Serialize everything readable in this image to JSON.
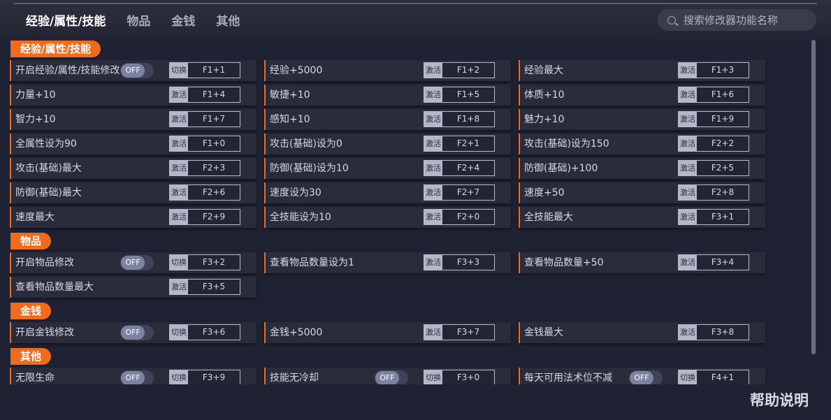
{
  "tabs": [
    {
      "label": "经验/属性/技能"
    },
    {
      "label": "物品"
    },
    {
      "label": "金钱"
    },
    {
      "label": "其他"
    }
  ],
  "search": {
    "placeholder": "搜索修改器功能名称"
  },
  "toggle_off": "OFF",
  "sections": [
    {
      "title": "经验/属性/技能",
      "rows": [
        [
          {
            "label": "开启经验/属性/技能修改",
            "toggle": true,
            "action": "切换",
            "hotkey": "F1+1"
          },
          {
            "label": "经验+5000",
            "action": "激活",
            "hotkey": "F1+2"
          },
          {
            "label": "经验最大",
            "action": "激活",
            "hotkey": "F1+3"
          }
        ],
        [
          {
            "label": "力量+10",
            "action": "激活",
            "hotkey": "F1+4"
          },
          {
            "label": "敏捷+10",
            "action": "激活",
            "hotkey": "F1+5"
          },
          {
            "label": "体质+10",
            "action": "激活",
            "hotkey": "F1+6"
          }
        ],
        [
          {
            "label": "智力+10",
            "action": "激活",
            "hotkey": "F1+7"
          },
          {
            "label": "感知+10",
            "action": "激活",
            "hotkey": "F1+8"
          },
          {
            "label": "魅力+10",
            "action": "激活",
            "hotkey": "F1+9"
          }
        ],
        [
          {
            "label": "全属性设为90",
            "action": "激活",
            "hotkey": "F1+0"
          },
          {
            "label": "攻击(基础)设为0",
            "action": "激活",
            "hotkey": "F2+1"
          },
          {
            "label": "攻击(基础)设为150",
            "action": "激活",
            "hotkey": "F2+2"
          }
        ],
        [
          {
            "label": "攻击(基础)最大",
            "action": "激活",
            "hotkey": "F2+3"
          },
          {
            "label": "防御(基础)设为10",
            "action": "激活",
            "hotkey": "F2+4"
          },
          {
            "label": "防御(基础)+100",
            "action": "激活",
            "hotkey": "F2+5"
          }
        ],
        [
          {
            "label": "防御(基础)最大",
            "action": "激活",
            "hotkey": "F2+6"
          },
          {
            "label": "速度设为30",
            "action": "激活",
            "hotkey": "F2+7"
          },
          {
            "label": "速度+50",
            "action": "激活",
            "hotkey": "F2+8"
          }
        ],
        [
          {
            "label": "速度最大",
            "action": "激活",
            "hotkey": "F2+9"
          },
          {
            "label": "全技能设为10",
            "action": "激活",
            "hotkey": "F2+0"
          },
          {
            "label": "全技能最大",
            "action": "激活",
            "hotkey": "F3+1"
          }
        ]
      ]
    },
    {
      "title": "物品",
      "rows": [
        [
          {
            "label": "开启物品修改",
            "toggle": true,
            "action": "切换",
            "hotkey": "F3+2"
          },
          {
            "label": "查看物品数量设为1",
            "action": "激活",
            "hotkey": "F3+3"
          },
          {
            "label": "查看物品数量+50",
            "action": "激活",
            "hotkey": "F3+4"
          }
        ],
        [
          {
            "label": "查看物品数量最大",
            "action": "激活",
            "hotkey": "F3+5"
          }
        ]
      ]
    },
    {
      "title": "金钱",
      "rows": [
        [
          {
            "label": "开启金钱修改",
            "toggle": true,
            "action": "切换",
            "hotkey": "F3+6"
          },
          {
            "label": "金钱+5000",
            "action": "激活",
            "hotkey": "F3+7"
          },
          {
            "label": "金钱最大",
            "action": "激活",
            "hotkey": "F3+8"
          }
        ]
      ]
    },
    {
      "title": "其他",
      "rows": [
        [
          {
            "label": "无限生命",
            "toggle": true,
            "action": "切换",
            "hotkey": "F3+9"
          },
          {
            "label": "技能无冷却",
            "toggle": true,
            "action": "切换",
            "hotkey": "F3+0"
          },
          {
            "label": "每天可用法术位不减",
            "toggle": true,
            "action": "切换",
            "hotkey": "F4+1"
          }
        ]
      ]
    }
  ],
  "help": {
    "label": "帮助说明"
  },
  "colors": {
    "accent": "#f26a1b",
    "background": "#1f2233",
    "cell": "#2a2c3b"
  }
}
